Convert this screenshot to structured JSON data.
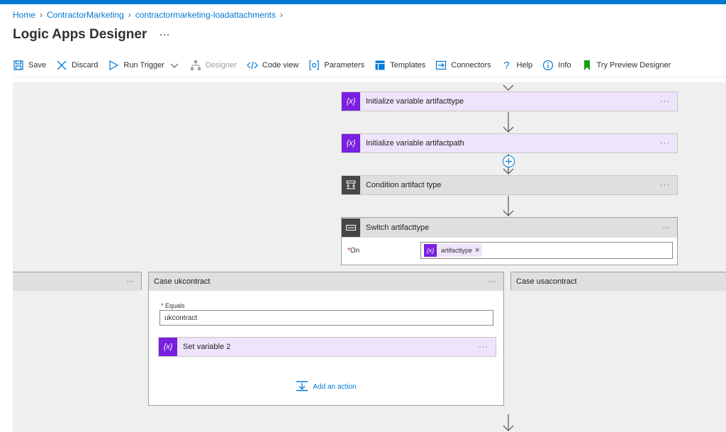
{
  "breadcrumb": {
    "home": "Home",
    "item1": "ContractorMarketing",
    "item2": "contractormarketing-loadattachments"
  },
  "page": {
    "title": "Logic Apps Designer",
    "more": "···"
  },
  "toolbar": {
    "save": "Save",
    "discard": "Discard",
    "run_trigger": "Run Trigger",
    "designer": "Designer",
    "code_view": "Code view",
    "parameters": "Parameters",
    "templates": "Templates",
    "connectors": "Connectors",
    "help": "Help",
    "info": "Info",
    "try_preview": "Try Preview Designer"
  },
  "colors": {
    "accent": "#0078d4",
    "variable": "#7a1fe0",
    "variable_bg": "#eee4fb",
    "control": "#484644"
  },
  "steps": {
    "init_type": {
      "label": "Initialize variable artifacttype",
      "icon": "variable-icon"
    },
    "init_path": {
      "label": "Initialize variable artifactpath",
      "icon": "variable-icon"
    },
    "condition": {
      "label": "Condition artifact type",
      "icon": "condition-icon"
    },
    "switch": {
      "label": "Switch artifacttype",
      "icon": "switch-icon",
      "on_label": "On",
      "on_token": "artifacttype"
    }
  },
  "cases": {
    "uk": {
      "title": "Case ukcontract",
      "equals_label": "Equals",
      "equals_value": "ukcontract",
      "action": "Set variable 2",
      "add_action": "Add an action"
    },
    "us": {
      "title": "Case usacontract"
    }
  },
  "more_label": "···",
  "icon_text": {
    "variable": "{x}"
  }
}
